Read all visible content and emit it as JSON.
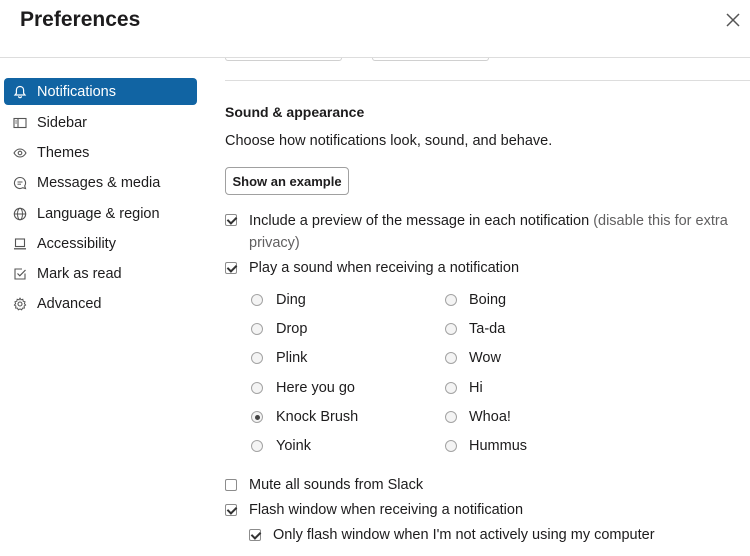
{
  "window": {
    "title": "Preferences"
  },
  "sidebar": {
    "items": [
      {
        "label": "Notifications",
        "icon": "bell-icon",
        "active": true
      },
      {
        "label": "Sidebar",
        "icon": "sidebar-icon"
      },
      {
        "label": "Themes",
        "icon": "eye-icon"
      },
      {
        "label": "Messages & media",
        "icon": "message-icon"
      },
      {
        "label": "Language & region",
        "icon": "globe-icon"
      },
      {
        "label": "Accessibility",
        "icon": "laptop-icon"
      },
      {
        "label": "Mark as read",
        "icon": "check-square-icon"
      },
      {
        "label": "Advanced",
        "icon": "gear-icon"
      }
    ]
  },
  "main": {
    "section_title": "Sound & appearance",
    "section_desc": "Choose how notifications look, sound, and behave.",
    "example_button": "Show an example",
    "preview": {
      "label": "Include a preview of the message in each notification",
      "hint_line1": "(disable this for extra",
      "hint_line2": "privacy)",
      "checked": true
    },
    "play_sound": {
      "label": "Play a sound when receiving a notification",
      "checked": true
    },
    "sounds": {
      "left": [
        "Ding",
        "Drop",
        "Plink",
        "Here you go",
        "Knock Brush",
        "Yoink"
      ],
      "right": [
        "Boing",
        "Ta-da",
        "Wow",
        "Hi",
        "Whoa!",
        "Hummus"
      ],
      "selected": "Knock Brush"
    },
    "mute": {
      "label": "Mute all sounds from Slack",
      "checked": false
    },
    "flash": {
      "label": "Flash window when receiving a notification",
      "checked": true
    },
    "flash_only": {
      "label": "Only flash window when I'm not actively using my computer",
      "checked": true
    }
  },
  "colors": {
    "active_bg": "#1164a3",
    "text": "#1d1c1d",
    "muted": "#616061",
    "divider": "#dddddd"
  }
}
